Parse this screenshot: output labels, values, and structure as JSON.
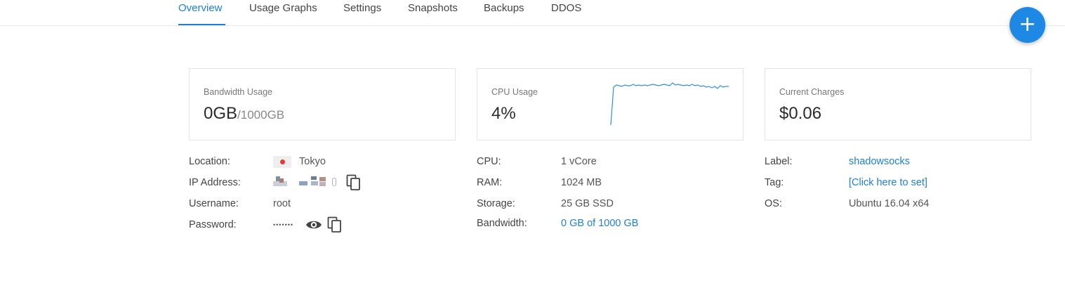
{
  "tabs": [
    {
      "label": "Overview",
      "active": true
    },
    {
      "label": "Usage Graphs"
    },
    {
      "label": "Settings"
    },
    {
      "label": "Snapshots"
    },
    {
      "label": "Backups"
    },
    {
      "label": "DDOS"
    }
  ],
  "fab": {
    "label": "+"
  },
  "cards": {
    "bandwidth": {
      "label": "Bandwidth Usage",
      "value": "0GB",
      "total": "/1000GB"
    },
    "cpu": {
      "label": "CPU Usage",
      "value": "4%"
    },
    "charges": {
      "label": "Current Charges",
      "value": "$0.06"
    }
  },
  "server": {
    "location": {
      "key": "Location:",
      "value": "Tokyo"
    },
    "ip": {
      "key": "IP Address:"
    },
    "username": {
      "key": "Username:",
      "value": "root"
    },
    "password": {
      "key": "Password:",
      "value": "•••••••"
    }
  },
  "specs": {
    "cpu": {
      "key": "CPU:",
      "value": "1 vCore"
    },
    "ram": {
      "key": "RAM:",
      "value": "1024 MB"
    },
    "storage": {
      "key": "Storage:",
      "value": "25 GB SSD"
    },
    "bandwidth": {
      "key": "Bandwidth:",
      "value": "0 GB of 1000 GB"
    }
  },
  "meta": {
    "label": {
      "key": "Label:",
      "value": "shadowsocks"
    },
    "tag": {
      "key": "Tag:",
      "value": "[Click here to set]"
    },
    "os": {
      "key": "OS:",
      "value": "Ubuntu 16.04 x64"
    }
  },
  "colors": {
    "accent": "#1e7fd6",
    "fab": "#1e88e5",
    "flag_red": "#e53935"
  },
  "icons": [
    "copy-icon",
    "eye-icon",
    "plus-icon",
    "japan-flag-icon"
  ]
}
